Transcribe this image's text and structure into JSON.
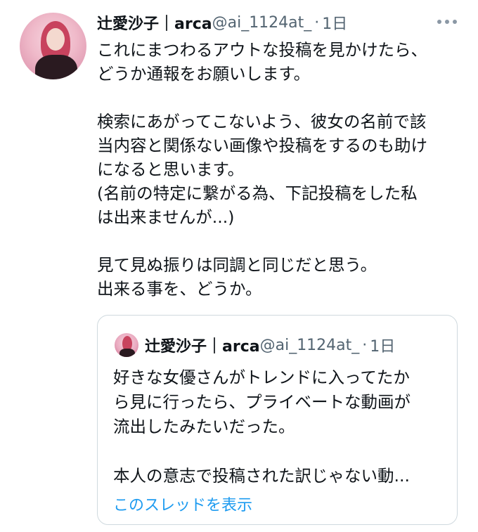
{
  "tweet": {
    "display_name": "辻愛沙子｜arca",
    "handle": "@ai_1124at_",
    "separator": "·",
    "time": "1日",
    "more_icon": "more-dots-icon",
    "avatar_icon": "profile-avatar",
    "body": "これにまつわるアウトな投稿を見かけたら、\nどうか通報をお願いします。\n\n検索にあがってこないよう、彼女の名前で該\n当内容と関係ない画像や投稿をするのも助け\nになると思います。\n(名前の特定に繋がる為、下記投稿をした私\nは出来ませんが...)\n\n見て見ぬ振りは同調と同じだと思う。\n出来る事を、どうか。"
  },
  "quote": {
    "display_name": "辻愛沙子｜arca",
    "handle": "@ai_1124at_",
    "separator": "·",
    "time": "1日",
    "body": "好きな女優さんがトレンドに入ってたか\nら見に行ったら、プライベートな動画が\n流出したみたいだった。\n\n本人の意志で投稿された訳じゃない動...",
    "thread_link": "このスレッドを表示"
  },
  "colors": {
    "text": "#0f1419",
    "secondary": "#536471",
    "link": "#1d9bf0",
    "border": "#cfd9de"
  }
}
